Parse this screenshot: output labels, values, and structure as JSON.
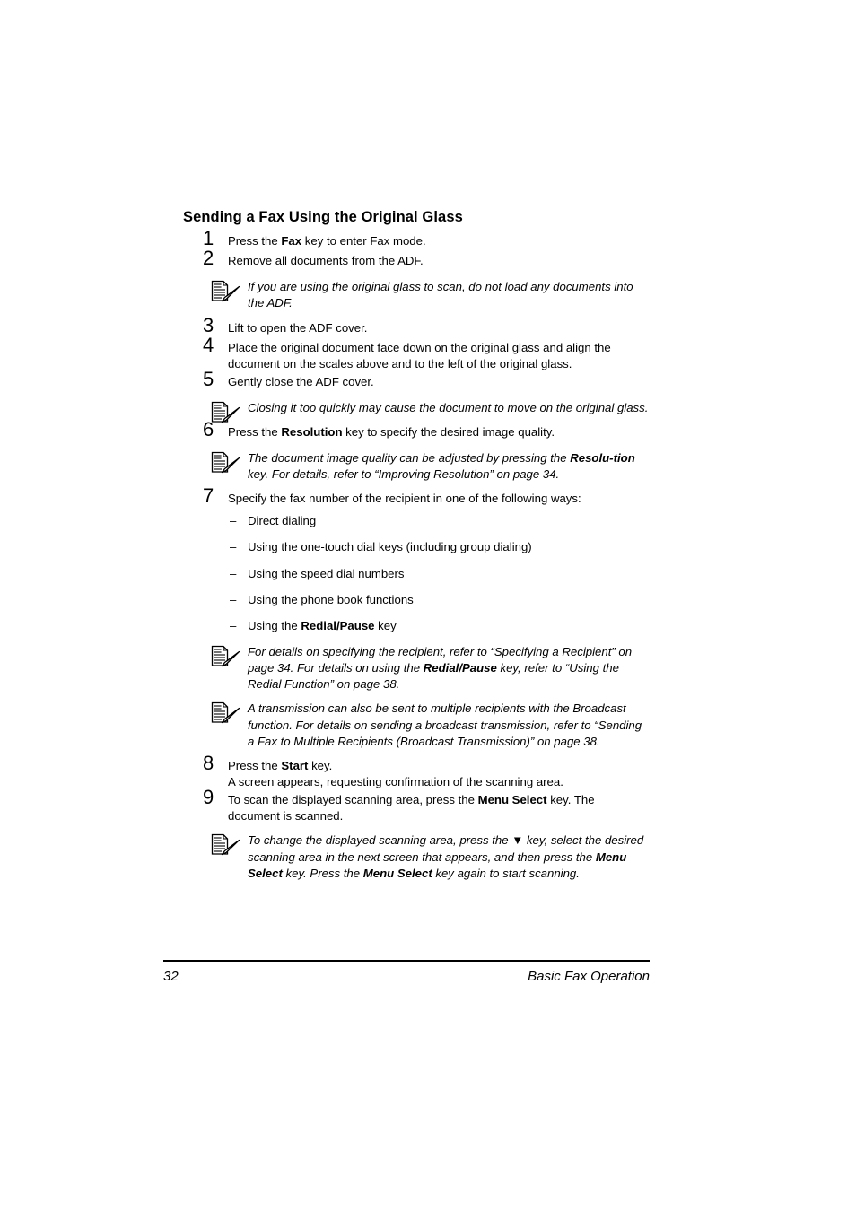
{
  "document": {
    "heading": "Sending a Fax Using the Original Glass",
    "note_icon_name": "note-memo-icon"
  },
  "steps": [
    {
      "number": "1",
      "text_before": "Press the ",
      "bold": "Fax",
      "text_after": " key to enter Fax mode."
    },
    {
      "number": "2",
      "text_before": "Remove all documents from the ADF.",
      "bold": "",
      "text_after": ""
    },
    {
      "number": "3",
      "text_before": "Lift to open the ADF cover.",
      "bold": "",
      "text_after": ""
    },
    {
      "number": "4",
      "text_before": "Place the original document face down on the original glass and align the document on the scales above and to the left of the original glass.",
      "bold": "",
      "text_after": ""
    },
    {
      "number": "5",
      "text_before": "Gently close the ADF cover.",
      "bold": "",
      "text_after": ""
    },
    {
      "number": "6",
      "text_before": "Press the ",
      "bold": "Resolution",
      "text_after": " key to specify the desired image quality."
    },
    {
      "number": "7",
      "text_before": "Specify the fax number of the recipient in one of the following ways:",
      "bold": "",
      "text_after": ""
    },
    {
      "number": "8",
      "text_before": "Press the ",
      "bold": "Start",
      "text_after": " key.",
      "second_line": "A screen appears, requesting confirmation of the scanning area."
    },
    {
      "number": "9",
      "text_before": "To scan the displayed scanning area, press the ",
      "bold": "Menu Select",
      "text_after": " key. The document is scanned."
    }
  ],
  "notes": {
    "note1": {
      "text": "If you are using the original glass to scan, do not load any documents into the ADF."
    },
    "note2": {
      "text": "Closing it too quickly may cause the document to move on the original glass."
    },
    "note3": {
      "part1": "The document image quality can be adjusted by pressing the ",
      "bold1": "Resolu-tion",
      "part2": " key. For details, refer to “Improving Resolution” on page 34."
    },
    "note4": {
      "part1": "For details on specifying the recipient, refer to “Specifying a Recipient” on page 34. For details on using the ",
      "bold1": "Redial/Pause",
      "part2": " key, refer to “Using the Redial Function” on page 38."
    },
    "note5": {
      "text": "A transmission can also be sent to multiple recipients with the Broadcast function. For details on sending a broadcast transmission, refer to “Sending a Fax to Multiple Recipients (Broadcast Transmission)” on page 38."
    },
    "note6": {
      "part1": "To change the displayed scanning area, press the ",
      "arrow": "▼",
      "part2": " key, select the desired scanning area in the next screen that appears, and then press the ",
      "bold1": "Menu Select",
      "part3": " key. Press the ",
      "bold2": "Menu Select",
      "part4": " key again to start scanning."
    }
  },
  "dial_methods": {
    "dash": "–",
    "items": [
      {
        "text_before": "Direct dialing",
        "bold": "",
        "text_after": ""
      },
      {
        "text_before": "Using the one-touch dial keys (including group dialing)",
        "bold": "",
        "text_after": ""
      },
      {
        "text_before": "Using the speed dial numbers",
        "bold": "",
        "text_after": ""
      },
      {
        "text_before": "Using the phone book functions",
        "bold": "",
        "text_after": ""
      },
      {
        "text_before": "Using the ",
        "bold": "Redial/Pause",
        "text_after": " key"
      }
    ]
  },
  "footer": {
    "page_number": "32",
    "title": "Basic Fax Operation"
  }
}
